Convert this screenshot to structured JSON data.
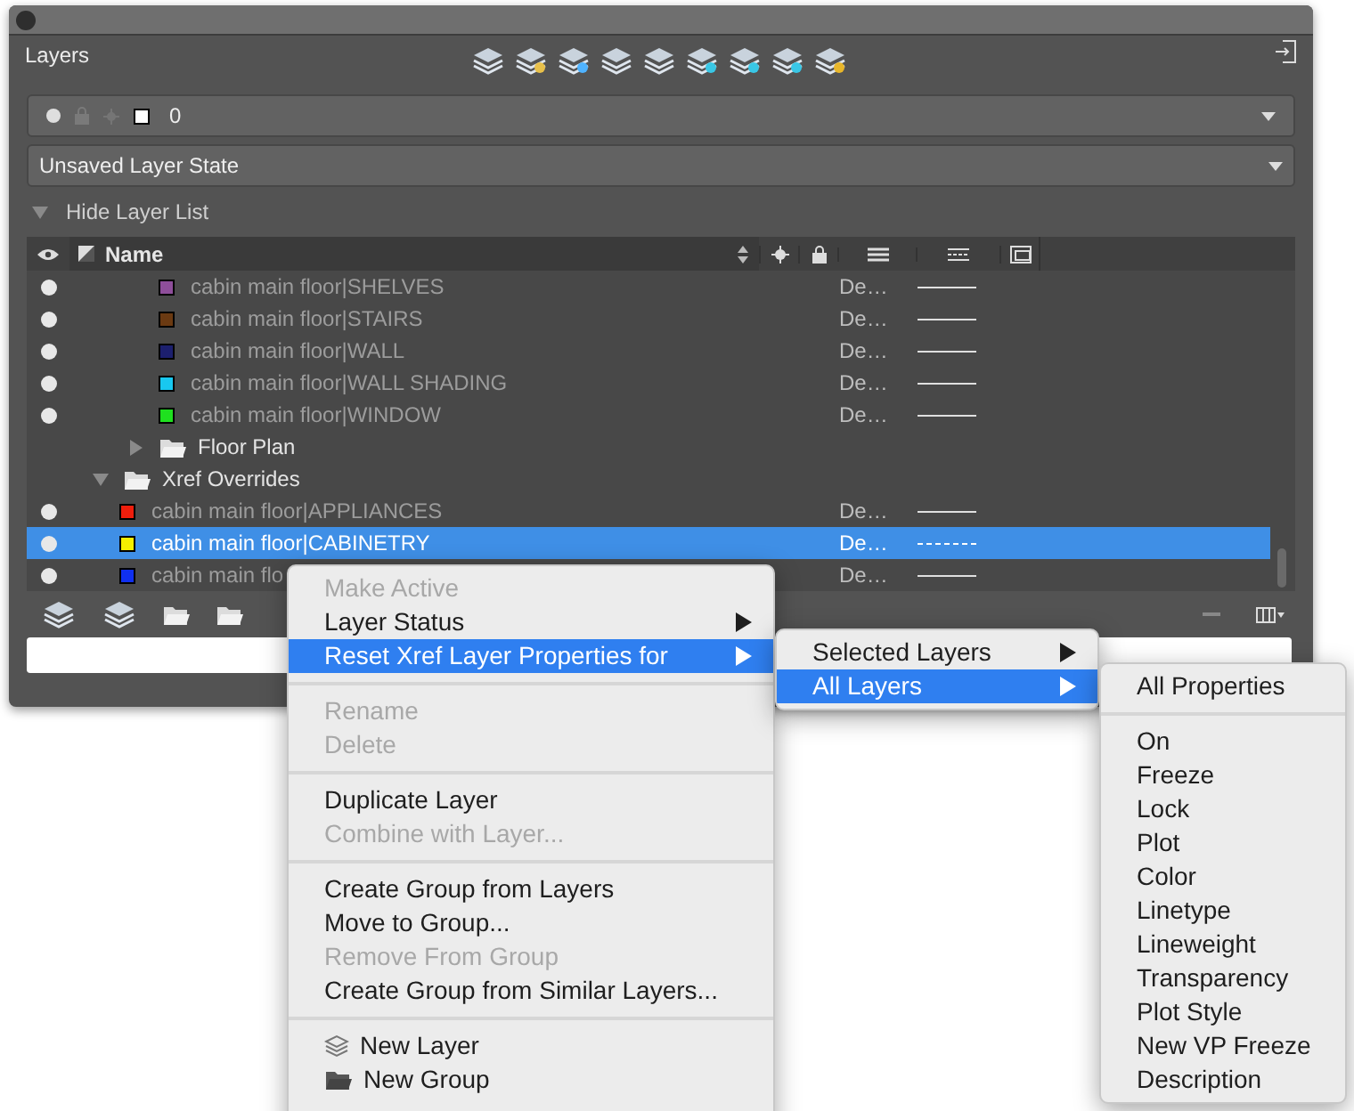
{
  "panel": {
    "title": "Layers"
  },
  "current_layer": {
    "name": "0"
  },
  "layer_state": {
    "value": "Unsaved Layer State"
  },
  "list_toggle": {
    "label": "Hide Layer List",
    "expanded": true
  },
  "table": {
    "name_column": "Name",
    "tree": [
      {
        "kind": "group",
        "children": [
          {
            "kind": "group",
            "children": [
              {
                "kind": "layer",
                "name": "cabin main floor|SHELVES",
                "color": "#8e4e9a",
                "on": true,
                "selected": false,
                "lineweight": "De…",
                "dashed": false
              },
              {
                "kind": "layer",
                "name": "cabin main floor|STAIRS",
                "color": "#6b3a12",
                "on": true,
                "selected": false,
                "lineweight": "De…",
                "dashed": false
              },
              {
                "kind": "layer",
                "name": "cabin main floor|WALL",
                "color": "#1c1f6e",
                "on": true,
                "selected": false,
                "lineweight": "De…",
                "dashed": false
              },
              {
                "kind": "layer",
                "name": "cabin main floor|WALL SHADING",
                "color": "#18c8f0",
                "on": true,
                "selected": false,
                "lineweight": "De…",
                "dashed": false
              },
              {
                "kind": "layer",
                "name": "cabin main floor|WINDOW",
                "color": "#1fe01f",
                "on": true,
                "selected": false,
                "lineweight": "De…",
                "dashed": false
              }
            ]
          },
          {
            "kind": "group",
            "name": "Floor Plan",
            "expanded": false
          }
        ]
      },
      {
        "kind": "group",
        "name": "Xref Overrides",
        "expanded": true,
        "children": [
          {
            "kind": "layer",
            "name": "cabin main floor|APPLIANCES",
            "color": "#f01e0c",
            "on": true,
            "selected": false,
            "lineweight": "De…",
            "dashed": false
          },
          {
            "kind": "layer",
            "name": "cabin main floor|CABINETRY",
            "color": "#f5f000",
            "on": true,
            "selected": true,
            "lineweight": "De…",
            "dashed": true
          },
          {
            "kind": "layer",
            "name": "cabin main flo",
            "color": "#1030f0",
            "on": true,
            "selected": false,
            "lineweight": "De…",
            "dashed": false
          }
        ]
      }
    ]
  },
  "context_menu": [
    {
      "kind": "item",
      "label": "Make Active",
      "disabled": true,
      "selected": false,
      "submenu": false
    },
    {
      "kind": "item",
      "label": "Layer Status",
      "disabled": false,
      "selected": false,
      "submenu": true
    },
    {
      "kind": "item",
      "label": "Reset Xref Layer Properties for",
      "disabled": false,
      "selected": true,
      "submenu": true
    },
    {
      "kind": "separator"
    },
    {
      "kind": "item",
      "label": "Rename",
      "disabled": true,
      "selected": false,
      "submenu": false
    },
    {
      "kind": "item",
      "label": "Delete",
      "disabled": true,
      "selected": false,
      "submenu": false
    },
    {
      "kind": "separator"
    },
    {
      "kind": "item",
      "label": "Duplicate Layer",
      "disabled": false,
      "selected": false,
      "submenu": false
    },
    {
      "kind": "item",
      "label": "Combine with Layer...",
      "disabled": true,
      "selected": false,
      "submenu": false
    },
    {
      "kind": "separator"
    },
    {
      "kind": "item",
      "label": "Create Group from Layers",
      "disabled": false,
      "selected": false,
      "submenu": false
    },
    {
      "kind": "item",
      "label": "Move to Group...",
      "disabled": false,
      "selected": false,
      "submenu": false
    },
    {
      "kind": "item",
      "label": "Remove From Group",
      "disabled": true,
      "selected": false,
      "submenu": false
    },
    {
      "kind": "item",
      "label": "Create Group from Similar Layers...",
      "disabled": false,
      "selected": false,
      "submenu": false
    },
    {
      "kind": "separator"
    },
    {
      "kind": "layer_item",
      "label": "New Layer",
      "disabled": false,
      "selected": false,
      "submenu": false
    },
    {
      "kind": "group_item",
      "label": "New Group",
      "disabled": false,
      "selected": false,
      "submenu": false
    }
  ],
  "reset_submenu": [
    {
      "kind": "item",
      "label": "Selected Layers",
      "disabled": false,
      "selected": false,
      "submenu": true
    },
    {
      "kind": "item",
      "label": "All Layers",
      "disabled": false,
      "selected": true,
      "submenu": true
    }
  ],
  "properties_submenu": [
    {
      "kind": "item",
      "label": "All Properties",
      "disabled": false,
      "selected": false,
      "submenu": false
    },
    {
      "kind": "separator"
    },
    {
      "kind": "item",
      "label": "On",
      "disabled": false,
      "selected": false,
      "submenu": false
    },
    {
      "kind": "item",
      "label": "Freeze",
      "disabled": false,
      "selected": false,
      "submenu": false
    },
    {
      "kind": "item",
      "label": "Lock",
      "disabled": false,
      "selected": false,
      "submenu": false
    },
    {
      "kind": "item",
      "label": "Plot",
      "disabled": false,
      "selected": false,
      "submenu": false
    },
    {
      "kind": "item",
      "label": "Color",
      "disabled": false,
      "selected": false,
      "submenu": false
    },
    {
      "kind": "item",
      "label": "Linetype",
      "disabled": false,
      "selected": false,
      "submenu": false
    },
    {
      "kind": "item",
      "label": "Lineweight",
      "disabled": false,
      "selected": false,
      "submenu": false
    },
    {
      "kind": "item",
      "label": "Transparency",
      "disabled": false,
      "selected": false,
      "submenu": false
    },
    {
      "kind": "item",
      "label": "Plot Style",
      "disabled": false,
      "selected": false,
      "submenu": false
    },
    {
      "kind": "item",
      "label": "New VP Freeze",
      "disabled": false,
      "selected": false,
      "submenu": false
    },
    {
      "kind": "item",
      "label": "Description",
      "disabled": false,
      "selected": false,
      "submenu": false
    }
  ]
}
